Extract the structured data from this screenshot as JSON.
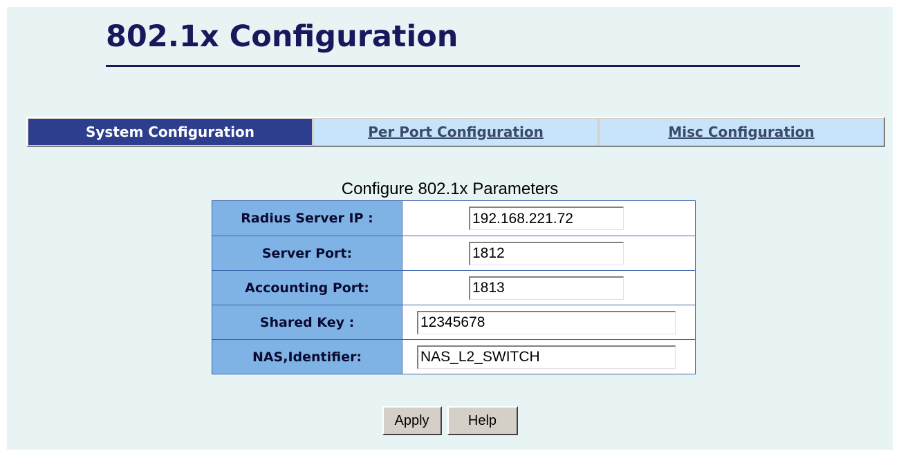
{
  "page": {
    "title": "802.1x Configuration"
  },
  "tabs": [
    {
      "label": "System Configuration",
      "active": true
    },
    {
      "label": "Per Port Configuration",
      "active": false
    },
    {
      "label": "Misc Configuration",
      "active": false
    }
  ],
  "form": {
    "title": "Configure 802.1x Parameters",
    "fields": [
      {
        "label": "Radius Server IP :",
        "value": "192.168.221.72"
      },
      {
        "label": "Server Port:",
        "value": "1812"
      },
      {
        "label": "Accounting Port:",
        "value": "1813"
      },
      {
        "label": "Shared Key :",
        "value": "12345678"
      },
      {
        "label": "NAS,Identifier:",
        "value": "NAS_L2_SWITCH"
      }
    ]
  },
  "buttons": {
    "apply_label": "Apply",
    "help_label": "Help"
  },
  "colors": {
    "title": "#18185c",
    "page_background": "#e8f4f4",
    "active_tab": "#2e3e8f",
    "inactive_tab": "#c8e4fb",
    "label_cell": "#7fb3e6",
    "table_border": "#3a62a8"
  }
}
